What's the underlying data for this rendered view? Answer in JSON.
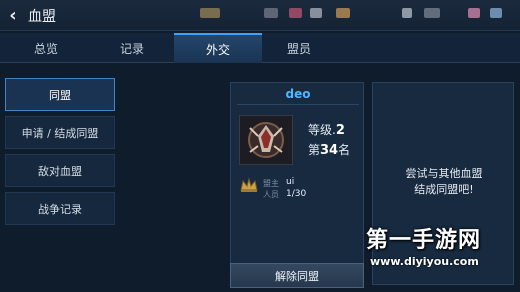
{
  "header": {
    "title": "血盟",
    "back_icon": "chevron-left-icon"
  },
  "tabs": [
    {
      "label": "总览",
      "active": false
    },
    {
      "label": "记录",
      "active": false
    },
    {
      "label": "外交",
      "active": true
    },
    {
      "label": "盟员",
      "active": false
    }
  ],
  "menu": [
    {
      "label": "同盟",
      "selected": true
    },
    {
      "label": "申请 / 结成同盟",
      "selected": false
    },
    {
      "label": "敌对血盟",
      "selected": false
    },
    {
      "label": "战争记录",
      "selected": false
    }
  ],
  "alliance": {
    "name": "deo",
    "level_label": "等级.",
    "level_value": "2",
    "rank_prefix": "第",
    "rank_value": "34",
    "rank_suffix": "名",
    "leader_label": "盟主",
    "leader_value": "ui",
    "members_label": "人员",
    "members_value": "1/30",
    "emblem_icon": "alliance-crest-icon"
  },
  "actions": {
    "dissolve_label": "解除同盟"
  },
  "right_panel": {
    "message": "尝试与其他血盟\n结成同盟吧!"
  },
  "watermark": {
    "main": "第一手游网",
    "url": "www.diyiyou.com"
  },
  "colors": {
    "accent": "#3da2ff",
    "alliance_name": "#4fb6ff",
    "background": "#0f1c2c"
  }
}
